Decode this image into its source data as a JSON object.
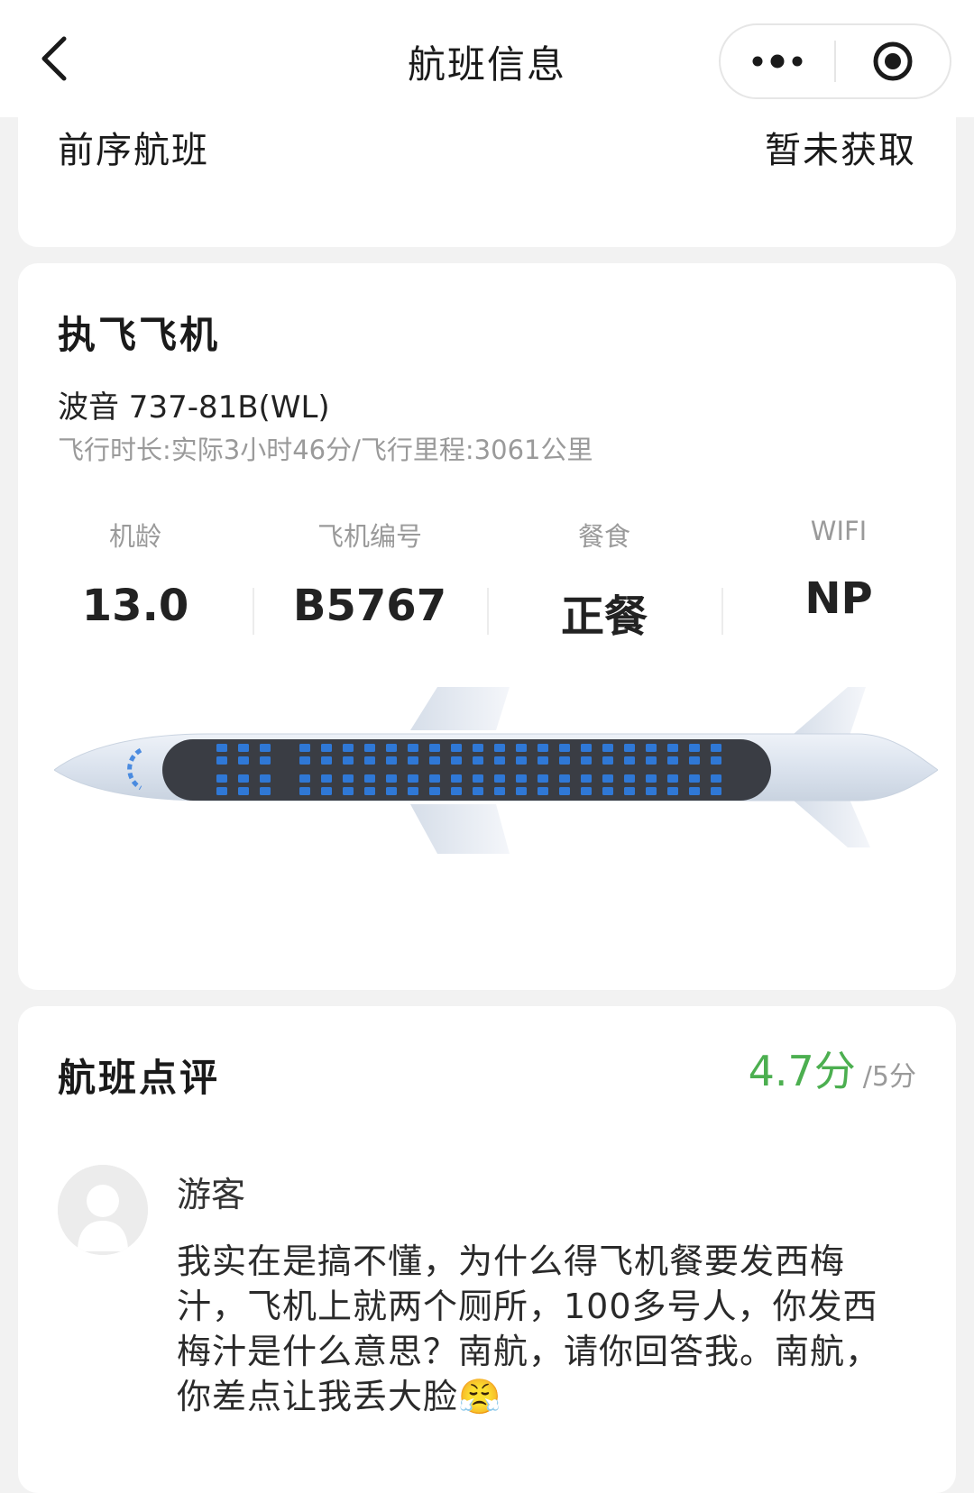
{
  "navbar": {
    "title": "航班信息",
    "back_icon": "chevron-left-icon",
    "more_icon": "more-dots-icon",
    "close_icon": "target-circle-icon"
  },
  "previous_flight": {
    "label": "前序航班",
    "value": "暂未获取"
  },
  "aircraft": {
    "title": "执飞飞机",
    "model": "波音 737-81B(WL)",
    "meta": "飞行时长:实际3小时46分/飞行里程:3061公里",
    "stats": [
      {
        "label": "机龄",
        "value": "13.0"
      },
      {
        "label": "飞机编号",
        "value": "B5767"
      },
      {
        "label": "餐食",
        "value": "正餐"
      },
      {
        "label": "WIFI",
        "value": "NP"
      }
    ],
    "seat_color": "#2f78d6"
  },
  "review_section": {
    "title": "航班点评",
    "score": "4.7分",
    "score_total": "/5分",
    "score_color": "#4caf50",
    "reviews": [
      {
        "name": "游客",
        "text": "我实在是搞不懂，为什么得飞机餐要发西梅汁，飞机上就两个厕所，100多号人，你发西梅汁是什么意思？南航，请你回答我。南航，你差点让我丢大脸😤"
      }
    ]
  }
}
